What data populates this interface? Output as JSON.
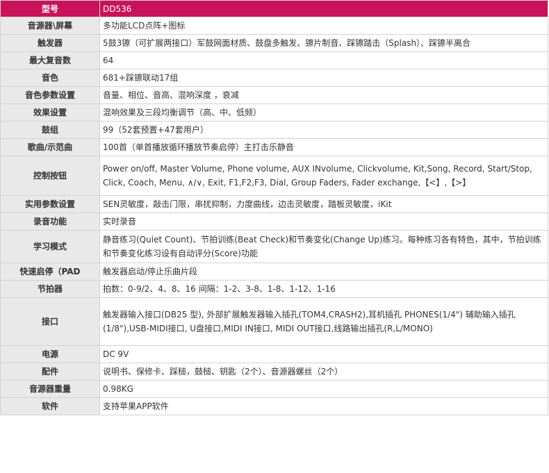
{
  "spec_table": {
    "accent_color": "#c8135b",
    "rows": [
      {
        "label": "型号",
        "value": "DD536"
      },
      {
        "label": "音源器\\屏幕",
        "value": "多功能LCD点阵+图标"
      },
      {
        "label": "触发器",
        "value": "5鼓3镲（可扩展两接口）军鼓网面材质、鼓盘多触发、镲片制音、踩镲踏击（Splash）、踩镲半离合"
      },
      {
        "label": "最大复音数",
        "value": "64"
      },
      {
        "label": "音色",
        "value": "681+踩镲联动17组"
      },
      {
        "label": "音色参数设置",
        "value": "音量、相位、音高、混响深度 ，衰减"
      },
      {
        "label": "效果设置",
        "value": "混响效果及三段均衡调节（高、中、低频）"
      },
      {
        "label": "鼓组",
        "value": "99（52套预置+47套用户）"
      },
      {
        "label": "歌曲/示范曲",
        "value": "100首（单首播放循环播放节奏启停）主打击乐静音"
      },
      {
        "label": "控制按钮",
        "value": "Power on/off, Master Volume, Phone volume, AUX INvolume, Clickvolume, Kit,Song, Record, Start/Stop, Click, Coach, Menu, ∧/∨, Exit, F1,F2,F3, Dial, Group Faders, Fader exchange,【<】,【>】"
      },
      {
        "label": "实用参数设置",
        "value": "SEN灵敏度，敲击门限，串扰抑制，力度曲线，边击灵敏度，踏板灵敏度，iKit"
      },
      {
        "label": "录音功能",
        "value": "实时录音"
      },
      {
        "label": "学习模式",
        "value": "静音练习(Quiet Count)、节拍训练(Beat Check)和节奏变化(Change Up)练习。每种练习各有特色，其中，节拍训练和节奏变化练习设有自动评分(Score)功能"
      },
      {
        "label": "快速启停（PAD",
        "value": "触发器启动/停止乐曲片段"
      },
      {
        "label": "节拍器",
        "value": "拍数：0-9/2、4、8、16  间隔：1-2、3-8、1-8、1-12、1-16"
      },
      {
        "label": "接口",
        "value": "触发器输入接口(DB25 型), 外部扩展触发器输入插孔(TOM4,CRASH2),耳机插孔 PHONES(1/4\")      辅助输入插孔(1/8\"),USB-MIDI接口, U盘接口,MIDI IN接口, MIDI OUT接口,线路输出插孔(R,L/MONO)"
      },
      {
        "label": "电源",
        "value": "DC 9V"
      },
      {
        "label": "配件",
        "value": "说明书、保修卡、踩槌，鼓槌、钥匙（2个）、音源器螺丝（2个）"
      },
      {
        "label": "音源器重量",
        "value": "0.98KG"
      },
      {
        "label": "软件",
        "value": "支持苹果APP软件"
      }
    ]
  }
}
